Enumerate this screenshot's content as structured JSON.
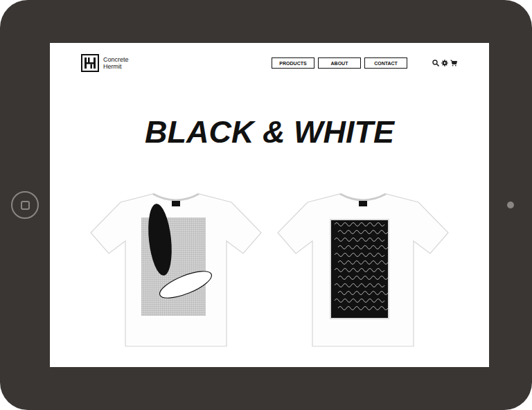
{
  "site": {
    "logo": {
      "line1": "Concrete",
      "line2": "Hermit"
    }
  },
  "nav": [
    {
      "label": "PRODUCTS"
    },
    {
      "label": "ABOUT"
    },
    {
      "label": "CONTACT"
    }
  ],
  "hero": {
    "title": "BLACK & WHITE"
  },
  "products": [
    {
      "kind": "ellipses"
    },
    {
      "kind": "pattern"
    }
  ]
}
